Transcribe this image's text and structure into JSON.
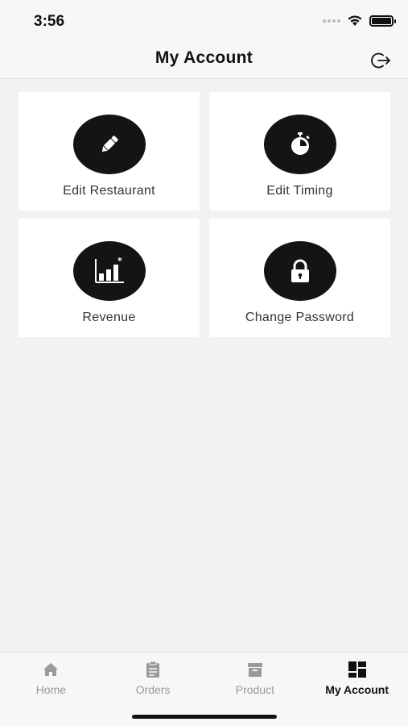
{
  "status_bar": {
    "time": "3:56"
  },
  "header": {
    "title": "My Account"
  },
  "cards": [
    {
      "label": "Edit Restaurant",
      "icon": "pencil-icon"
    },
    {
      "label": "Edit Timing",
      "icon": "stopwatch-icon"
    },
    {
      "label": "Revenue",
      "icon": "revenue-chart-icon"
    },
    {
      "label": "Change Password",
      "icon": "lock-icon"
    }
  ],
  "tabs": [
    {
      "label": "Home",
      "icon": "home-icon"
    },
    {
      "label": "Orders",
      "icon": "clipboard-icon"
    },
    {
      "label": "Product",
      "icon": "box-icon"
    },
    {
      "label": "My Account",
      "icon": "dashboard-icon",
      "active": true
    }
  ],
  "colors": {
    "icon_circle": "#141414",
    "background": "#f2f2f2",
    "inactive_tab": "#9a9a9a"
  }
}
